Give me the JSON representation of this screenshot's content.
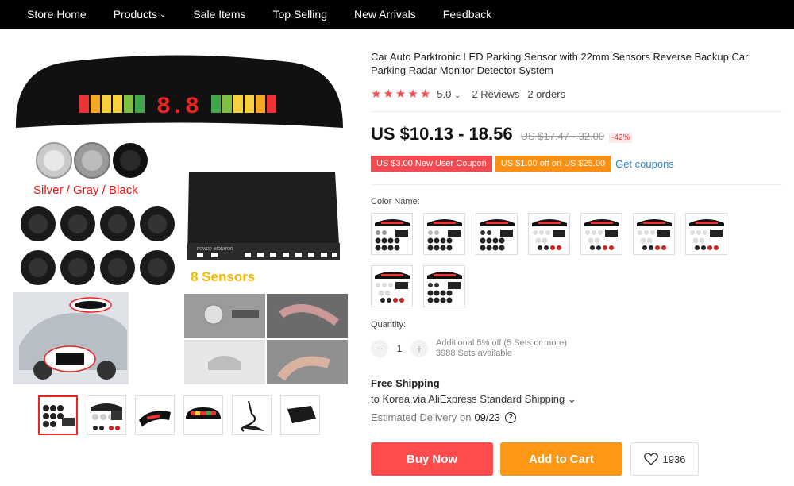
{
  "nav": {
    "items": [
      {
        "label": "Store Home"
      },
      {
        "label": "Products",
        "caret": "⌄"
      },
      {
        "label": "Sale Items"
      },
      {
        "label": "Top Selling"
      },
      {
        "label": "New Arrivals"
      },
      {
        "label": "Feedback"
      }
    ]
  },
  "gallery": {
    "display_digits": "8.8",
    "color_caption": "Silver /  Gray  / Black",
    "sensors_caption": "8 Sensors",
    "kit_labels": [
      "POWER",
      "MONITOR",
      "E",
      "F",
      "G",
      "H",
      "A",
      "B",
      "C",
      "D"
    ]
  },
  "product": {
    "title": "Car Auto Parktronic LED Parking Sensor with 22mm Sensors Reverse Backup Car Parking Radar Monitor Detector System",
    "rating": "5.0",
    "rating_caret": "⌄",
    "reviews": "2 Reviews",
    "orders": "2 orders",
    "price": "US $10.13 - 18.56",
    "old_price": "US $17.47 - 32.00",
    "discount": "-42%",
    "coupons": [
      "US $3.00 New User Coupon",
      "US $1.00 off on US $25.00"
    ],
    "get_coupons": "Get coupons",
    "color_label": "Color Name:",
    "quantity_label": "Quantity:",
    "quantity": "1",
    "qty_minus": "−",
    "qty_plus": "+",
    "qty_note_1": "Additional 5% off (5 Sets or more)",
    "qty_note_2": "3988 Sets available",
    "shipping_title": "Free Shipping",
    "shipping_via": "to Korea via AliExpress Standard Shipping ⌄",
    "eta_label": "Estimated Delivery on",
    "eta_date": "09/23",
    "help_glyph": "?",
    "buy_now": "Buy Now",
    "add_to_cart": "Add to Cart",
    "wishlist_count": "1936"
  },
  "colors": {
    "accent": "#f24c52",
    "coupon_orange": "#fd8f15",
    "cart_orange": "#fd9716",
    "link": "#2f84c9"
  }
}
